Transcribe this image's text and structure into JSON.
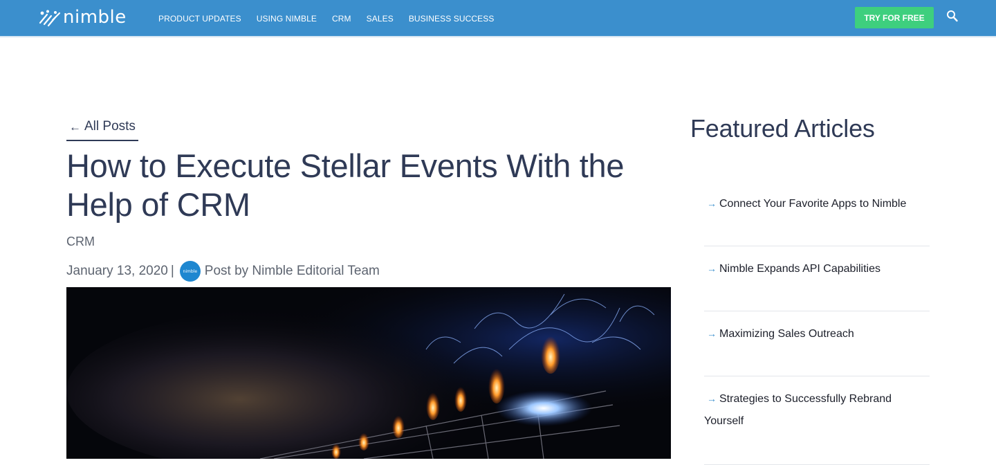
{
  "header": {
    "logo_text": "nimble",
    "nav": [
      "PRODUCT UPDATES",
      "USING NIMBLE",
      "CRM",
      "SALES",
      "BUSINESS SUCCESS"
    ],
    "cta_label": "TRY FOR FREE",
    "search_icon": "search-icon"
  },
  "article": {
    "back_label": "All Posts",
    "title": "How to Execute Stellar Events With the Help of CRM",
    "category": "CRM",
    "date": "January 13, 2020",
    "separator": "|",
    "author_line": "Post by Nimble Editorial Team",
    "avatar_text": "nimble"
  },
  "sidebar": {
    "heading": "Featured Articles",
    "items": [
      "Connect Your Favorite Apps to Nimble",
      "Nimble Expands API Capabilities",
      "Maximizing Sales Outreach",
      "Strategies to Successfully Rebrand Yourself"
    ]
  },
  "colors": {
    "header_bg": "#3b8fcd",
    "cta_bg": "#3ecf7e",
    "title_text": "#2f3a56",
    "link_arrow": "#3b8fcd"
  }
}
